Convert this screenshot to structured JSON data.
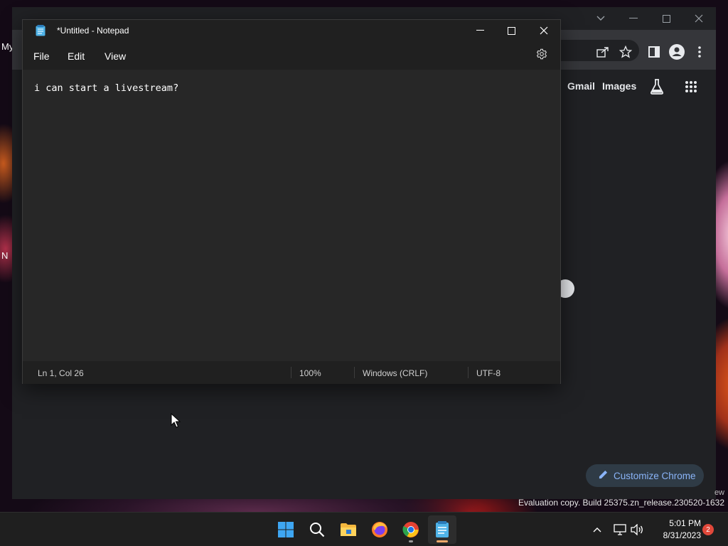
{
  "desktop": {
    "fragments": [
      "My",
      "N"
    ]
  },
  "chrome": {
    "header_links": [
      "Gmail",
      "Images"
    ],
    "customize_label": "Customize Chrome",
    "icons": [
      "share-icon",
      "star-icon",
      "side-panel-icon",
      "profile-icon",
      "menu-icon",
      "labs-icon",
      "apps-grid-icon"
    ]
  },
  "notepad": {
    "title": "*Untitled - Notepad",
    "menu": [
      "File",
      "Edit",
      "View"
    ],
    "content": "i can start a livestream?",
    "status": {
      "position": "Ln 1, Col 26",
      "zoom": "100%",
      "line_ending": "Windows (CRLF)",
      "encoding": "UTF-8"
    }
  },
  "watermark": {
    "stub": "ew",
    "text": "Evaluation copy. Build 25375.zn_release.230520-1632"
  },
  "taskbar": {
    "apps": [
      "start-icon",
      "search-icon",
      "file-explorer-icon",
      "firefox-icon",
      "chrome-icon",
      "notepad-icon"
    ],
    "clock_time": "5:01 PM",
    "clock_date": "8/31/2023",
    "notification_count": "2",
    "colors": {
      "accent_indicator": "#f0a96a",
      "running_indicator": "#9a9a9a"
    }
  }
}
